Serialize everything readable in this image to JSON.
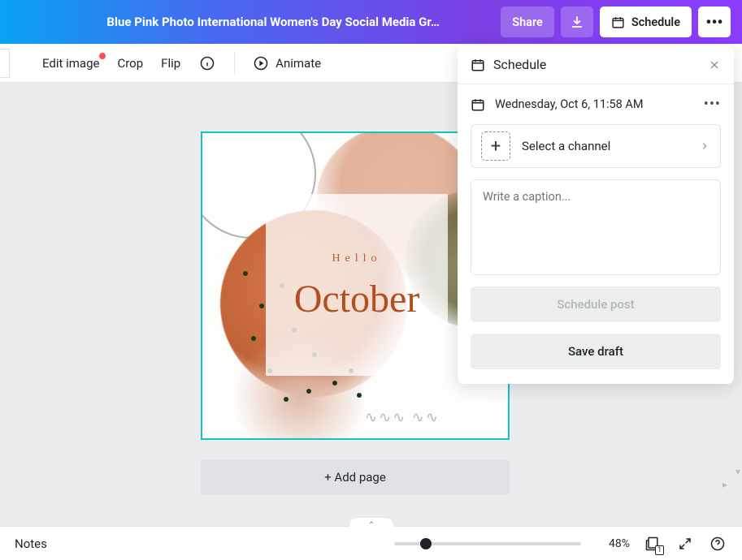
{
  "header": {
    "title": "Blue Pink Photo International Women's Day Social Media Gr…",
    "share_label": "Share",
    "schedule_label": "Schedule"
  },
  "toolbar": {
    "edit_image": "Edit image",
    "crop": "Crop",
    "flip": "Flip",
    "animate": "Animate"
  },
  "canvas": {
    "hello": "Hello",
    "month": "October",
    "add_page": "+ Add page"
  },
  "schedule_panel": {
    "title": "Schedule",
    "date": "Wednesday, Oct 6, 11:58 AM",
    "select_channel": "Select a channel",
    "caption_placeholder": "Write a caption...",
    "schedule_post": "Schedule post",
    "save_draft": "Save draft"
  },
  "bottom": {
    "notes": "Notes",
    "zoom": "48%",
    "page_count": "1"
  }
}
